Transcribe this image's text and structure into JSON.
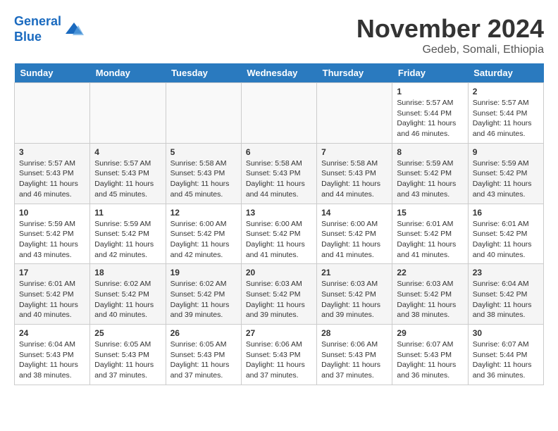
{
  "logo": {
    "line1": "General",
    "line2": "Blue"
  },
  "title": "November 2024",
  "location": "Gedeb, Somali, Ethiopia",
  "days_of_week": [
    "Sunday",
    "Monday",
    "Tuesday",
    "Wednesday",
    "Thursday",
    "Friday",
    "Saturday"
  ],
  "weeks": [
    [
      {
        "day": "",
        "content": ""
      },
      {
        "day": "",
        "content": ""
      },
      {
        "day": "",
        "content": ""
      },
      {
        "day": "",
        "content": ""
      },
      {
        "day": "",
        "content": ""
      },
      {
        "day": "1",
        "content": "Sunrise: 5:57 AM\nSunset: 5:44 PM\nDaylight: 11 hours and 46 minutes."
      },
      {
        "day": "2",
        "content": "Sunrise: 5:57 AM\nSunset: 5:44 PM\nDaylight: 11 hours and 46 minutes."
      }
    ],
    [
      {
        "day": "3",
        "content": "Sunrise: 5:57 AM\nSunset: 5:43 PM\nDaylight: 11 hours and 46 minutes."
      },
      {
        "day": "4",
        "content": "Sunrise: 5:57 AM\nSunset: 5:43 PM\nDaylight: 11 hours and 45 minutes."
      },
      {
        "day": "5",
        "content": "Sunrise: 5:58 AM\nSunset: 5:43 PM\nDaylight: 11 hours and 45 minutes."
      },
      {
        "day": "6",
        "content": "Sunrise: 5:58 AM\nSunset: 5:43 PM\nDaylight: 11 hours and 44 minutes."
      },
      {
        "day": "7",
        "content": "Sunrise: 5:58 AM\nSunset: 5:43 PM\nDaylight: 11 hours and 44 minutes."
      },
      {
        "day": "8",
        "content": "Sunrise: 5:59 AM\nSunset: 5:42 PM\nDaylight: 11 hours and 43 minutes."
      },
      {
        "day": "9",
        "content": "Sunrise: 5:59 AM\nSunset: 5:42 PM\nDaylight: 11 hours and 43 minutes."
      }
    ],
    [
      {
        "day": "10",
        "content": "Sunrise: 5:59 AM\nSunset: 5:42 PM\nDaylight: 11 hours and 43 minutes."
      },
      {
        "day": "11",
        "content": "Sunrise: 5:59 AM\nSunset: 5:42 PM\nDaylight: 11 hours and 42 minutes."
      },
      {
        "day": "12",
        "content": "Sunrise: 6:00 AM\nSunset: 5:42 PM\nDaylight: 11 hours and 42 minutes."
      },
      {
        "day": "13",
        "content": "Sunrise: 6:00 AM\nSunset: 5:42 PM\nDaylight: 11 hours and 41 minutes."
      },
      {
        "day": "14",
        "content": "Sunrise: 6:00 AM\nSunset: 5:42 PM\nDaylight: 11 hours and 41 minutes."
      },
      {
        "day": "15",
        "content": "Sunrise: 6:01 AM\nSunset: 5:42 PM\nDaylight: 11 hours and 41 minutes."
      },
      {
        "day": "16",
        "content": "Sunrise: 6:01 AM\nSunset: 5:42 PM\nDaylight: 11 hours and 40 minutes."
      }
    ],
    [
      {
        "day": "17",
        "content": "Sunrise: 6:01 AM\nSunset: 5:42 PM\nDaylight: 11 hours and 40 minutes."
      },
      {
        "day": "18",
        "content": "Sunrise: 6:02 AM\nSunset: 5:42 PM\nDaylight: 11 hours and 40 minutes."
      },
      {
        "day": "19",
        "content": "Sunrise: 6:02 AM\nSunset: 5:42 PM\nDaylight: 11 hours and 39 minutes."
      },
      {
        "day": "20",
        "content": "Sunrise: 6:03 AM\nSunset: 5:42 PM\nDaylight: 11 hours and 39 minutes."
      },
      {
        "day": "21",
        "content": "Sunrise: 6:03 AM\nSunset: 5:42 PM\nDaylight: 11 hours and 39 minutes."
      },
      {
        "day": "22",
        "content": "Sunrise: 6:03 AM\nSunset: 5:42 PM\nDaylight: 11 hours and 38 minutes."
      },
      {
        "day": "23",
        "content": "Sunrise: 6:04 AM\nSunset: 5:42 PM\nDaylight: 11 hours and 38 minutes."
      }
    ],
    [
      {
        "day": "24",
        "content": "Sunrise: 6:04 AM\nSunset: 5:43 PM\nDaylight: 11 hours and 38 minutes."
      },
      {
        "day": "25",
        "content": "Sunrise: 6:05 AM\nSunset: 5:43 PM\nDaylight: 11 hours and 37 minutes."
      },
      {
        "day": "26",
        "content": "Sunrise: 6:05 AM\nSunset: 5:43 PM\nDaylight: 11 hours and 37 minutes."
      },
      {
        "day": "27",
        "content": "Sunrise: 6:06 AM\nSunset: 5:43 PM\nDaylight: 11 hours and 37 minutes."
      },
      {
        "day": "28",
        "content": "Sunrise: 6:06 AM\nSunset: 5:43 PM\nDaylight: 11 hours and 37 minutes."
      },
      {
        "day": "29",
        "content": "Sunrise: 6:07 AM\nSunset: 5:43 PM\nDaylight: 11 hours and 36 minutes."
      },
      {
        "day": "30",
        "content": "Sunrise: 6:07 AM\nSunset: 5:44 PM\nDaylight: 11 hours and 36 minutes."
      }
    ]
  ]
}
